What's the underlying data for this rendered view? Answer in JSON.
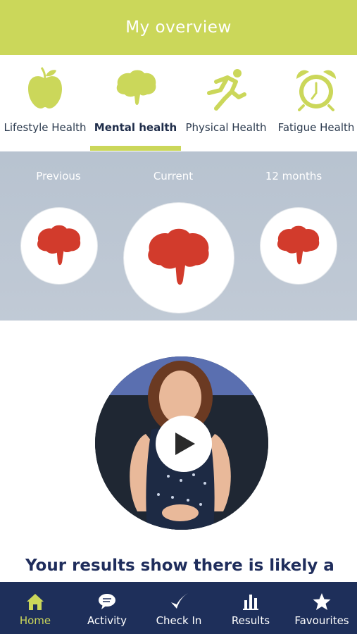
{
  "header": {
    "title": "My overview"
  },
  "tabs": [
    {
      "label": "Lifestyle Health",
      "icon": "apple-icon"
    },
    {
      "label": "Mental health",
      "icon": "brain-icon",
      "active": true
    },
    {
      "label": "Physical Health",
      "icon": "running-person-icon"
    },
    {
      "label": "Fatigue Health",
      "icon": "alarm-clock-icon"
    }
  ],
  "comparison": {
    "previous_label": "Previous",
    "current_label": "Current",
    "months_label": "12 months",
    "icon": "brain-icon",
    "icon_color": "#d23b2c"
  },
  "video": {
    "play_icon": "play-icon"
  },
  "results": {
    "text": "Your results show there is likely a"
  },
  "bottom_nav": [
    {
      "label": "Home",
      "icon": "home-icon",
      "active": true
    },
    {
      "label": "Activity",
      "icon": "chat-bubble-icon"
    },
    {
      "label": "Check In",
      "icon": "checkmark-icon"
    },
    {
      "label": "Results",
      "icon": "bar-chart-icon"
    },
    {
      "label": "Favourites",
      "icon": "star-icon"
    }
  ],
  "colors": {
    "accent": "#cbd75a",
    "navy": "#1e2f5a",
    "brain_red": "#d23b2c"
  }
}
